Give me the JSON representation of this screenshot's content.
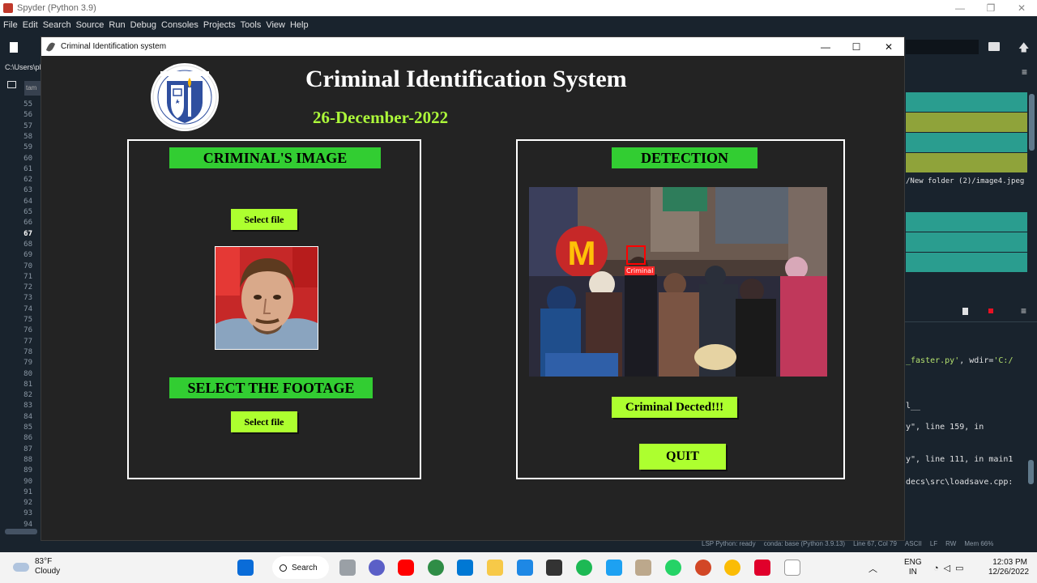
{
  "spyder": {
    "window_title": "Spyder (Python 3.9)",
    "menu": [
      "File",
      "Edit",
      "Search",
      "Source",
      "Run",
      "Debug",
      "Consoles",
      "Projects",
      "Tools",
      "View",
      "Help"
    ],
    "path_prefix": "C:\\Users\\pl",
    "editor_tab": "tam",
    "line_numbers": [
      "55",
      "56",
      "57",
      "58",
      "59",
      "60",
      "61",
      "62",
      "63",
      "64",
      "65",
      "66",
      "67",
      "68",
      "69",
      "70",
      "71",
      "72",
      "73",
      "74",
      "75",
      "76",
      "77",
      "78",
      "79",
      "80",
      "81",
      "82",
      "83",
      "84",
      "85",
      "86",
      "87",
      "88",
      "89",
      "90",
      "91",
      "92",
      "93",
      "94"
    ],
    "active_line": "67",
    "variable_explorer_path": "/New folder (2)/image4.jpeg",
    "console_lines": [
      {
        "pre": "",
        "str": "_faster.py'",
        "post": ", wdir=",
        "str2": "'C:/"
      },
      {
        "pre": "l__",
        "str": "",
        "post": "",
        "str2": ""
      },
      {
        "pre": "y\", line 159, in",
        "str": "",
        "post": "",
        "str2": ""
      },
      {
        "pre": "y\", line 111, in main1",
        "str": "",
        "post": "",
        "str2": ""
      },
      {
        "pre": "decs\\src\\loadsave.cpp:",
        "str": "",
        "post": "",
        "str2": ""
      }
    ],
    "status": {
      "lsp": "LSP Python: ready",
      "conda": "conda: base (Python 3.9.13)",
      "position": "Line 67, Col 79",
      "encoding": "ASCII",
      "eol": "LF",
      "mode": "RW",
      "memory": "Mem 66%"
    }
  },
  "app": {
    "window_title": "Criminal Identification system",
    "title": "Criminal Identification System",
    "date": "26-December-2022",
    "left_panel": {
      "header": "CRIMINAL'S IMAGE",
      "select_image_button": "Select file",
      "footage_header": "SELECT THE FOOTAGE",
      "select_footage_button": "Select file"
    },
    "right_panel": {
      "header": "DETECTION",
      "detection_tag": "Criminal",
      "result_label": "Criminal Dected!!!",
      "quit_button": "QUIT"
    },
    "colors": {
      "header_green": "#32cd32",
      "button_green": "#adff2f",
      "date_green": "#adfa3a",
      "background": "#232323"
    }
  },
  "taskbar": {
    "weather_temp": "83°F",
    "weather_desc": "Cloudy",
    "search_label": "Search",
    "lang_1": "ENG",
    "lang_2": "IN",
    "time": "12:03 PM",
    "date": "12/26/2022"
  }
}
